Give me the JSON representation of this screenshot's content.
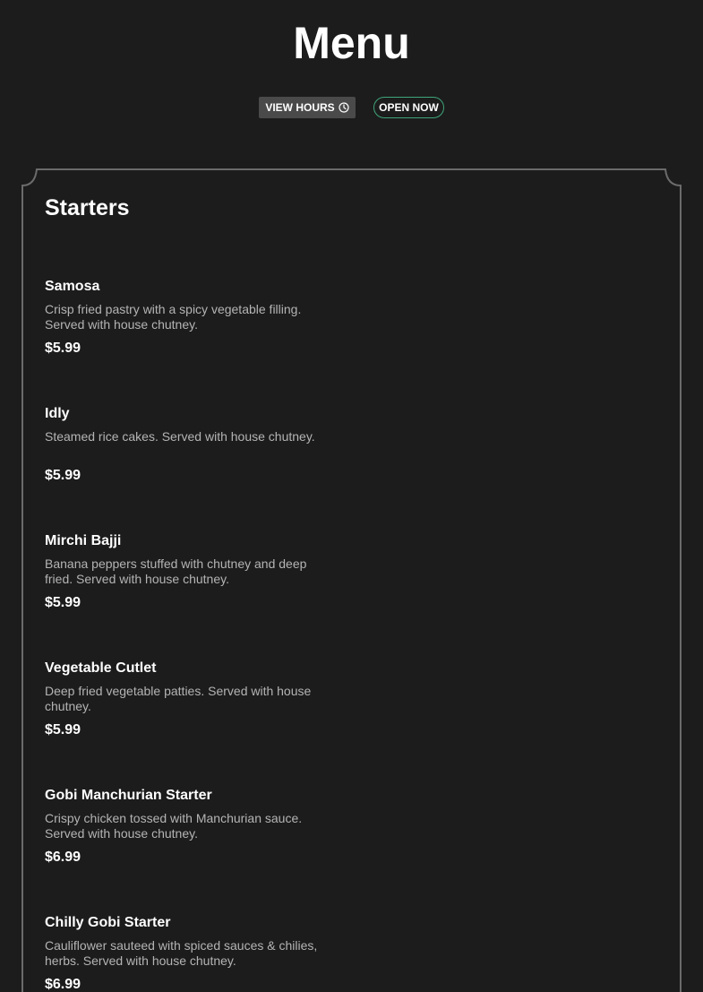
{
  "header": {
    "title": "Menu",
    "view_hours_label": "VIEW HOURS",
    "open_status": "OPEN NOW"
  },
  "section": {
    "title": "Starters",
    "items": [
      {
        "name": "Samosa",
        "description": "Crisp fried pastry with a spicy vegetable filling. Served with house chutney.",
        "price": "$5.99"
      },
      {
        "name": "Idly",
        "description": "Steamed rice cakes. Served with house chutney.",
        "price": "$5.99"
      },
      {
        "name": "Mirchi Bajji",
        "description": "Banana peppers stuffed with chutney and deep fried. Served with house chutney.",
        "price": "$5.99"
      },
      {
        "name": "Vegetable Cutlet",
        "description": "Deep fried vegetable patties. Served with house chutney.",
        "price": "$5.99"
      },
      {
        "name": "Gobi Manchurian Starter",
        "description": "Crispy chicken tossed with Manchurian sauce. Served with house chutney.",
        "price": "$6.99"
      },
      {
        "name": "Chilly Gobi Starter",
        "description": "Cauliflower sauteed with spiced sauces & chilies, herbs. Served with house chutney.",
        "price": "$6.99"
      }
    ]
  },
  "colors": {
    "background": "#1c1c1c",
    "frame_border": "#6b6b6b",
    "open_badge_border": "#3fa57a",
    "button_bg": "#4a4a4a",
    "description_text": "#b4b4b4"
  }
}
